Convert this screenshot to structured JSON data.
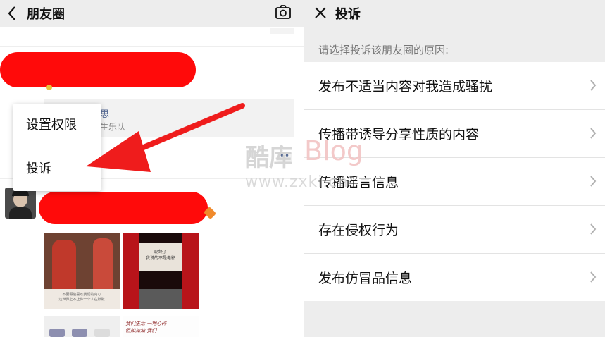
{
  "left_panel": {
    "title": "朋友圈",
    "popup_menu": {
      "item_permissions": "设置权限",
      "item_complain": "投诉"
    },
    "post": {
      "link_text_1": "思",
      "link_text_2": "生乐队"
    },
    "images": {
      "caption_a": "不要假装喜欢我们的内心\n这世界上不止你一个人在默默",
      "poster_text": "剧终了\n我说的不是电影",
      "note_text": "我们生活 一地心碎\n但如加油 我们"
    }
  },
  "right_panel": {
    "title": "投诉",
    "hint": "请选择投诉该朋友圈的原因:",
    "reasons": [
      "发布不适当内容对我造成骚扰",
      "传播带诱导分享性质的内容",
      "传播谣言信息",
      "存在侵权行为",
      "发布仿冒品信息"
    ]
  },
  "watermark": {
    "brand_cn": "酷库",
    "brand_en": "Blog",
    "url": "www.zxki.cn"
  },
  "colors": {
    "arrow": "#ef1c1c",
    "scribble": "#ff0a0a",
    "topbar": "#ededed"
  }
}
